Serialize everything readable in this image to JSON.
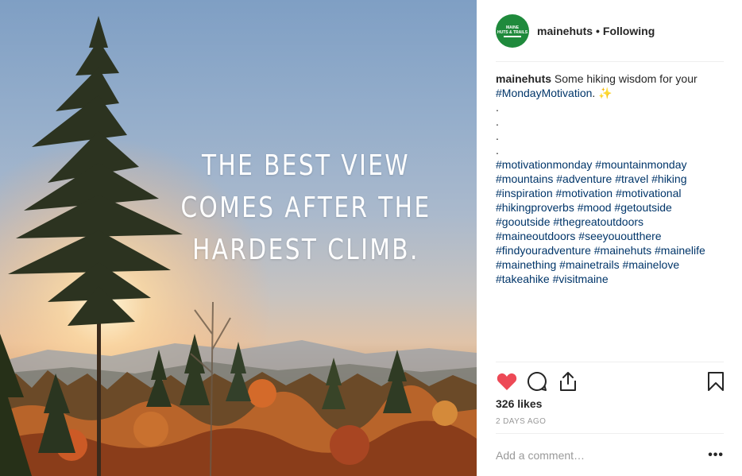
{
  "post": {
    "image_text": [
      "THE BEST VIEW",
      "COMES AFTER THE",
      "HARDEST CLIMB."
    ],
    "avatar_text": [
      "MAINE",
      "HUTS & TRAILS"
    ],
    "username": "mainehuts",
    "separator": "•",
    "follow_status": "Following",
    "caption": {
      "username": "mainehuts",
      "text": "Some hiking wisdom for your",
      "tag_main": "#MondayMotivation",
      "after_tag": ".",
      "emoji": "✨",
      "dots": [
        ".",
        ".",
        ".",
        "."
      ],
      "hashtag_lines": [
        "#motivationmonday #mountainmonday",
        "#mountains #adventure #travel #hiking",
        "#inspiration #motivation #motivational",
        "#hikingproverbs #mood #getoutside",
        "#gooutside #thegreatoutdoors",
        "#maineoutdoors #seeyououtthere",
        "#findyouradventure #mainehuts #mainelife",
        "#mainething #mainetrails #mainelove",
        "#takeahike #visitmaine"
      ]
    },
    "likes": "326 likes",
    "timestamp": "2 DAYS AGO",
    "comment_placeholder": "Add a comment…",
    "more_label": "•••",
    "icons": {
      "like": "heart-icon",
      "comment": "comment-bubble-icon",
      "share": "share-icon",
      "save": "bookmark-icon"
    },
    "colors": {
      "liked_heart": "#ed4956",
      "hashtag": "#003569",
      "avatar_bg": "#1f8a3c",
      "muted_text": "#999999"
    }
  }
}
